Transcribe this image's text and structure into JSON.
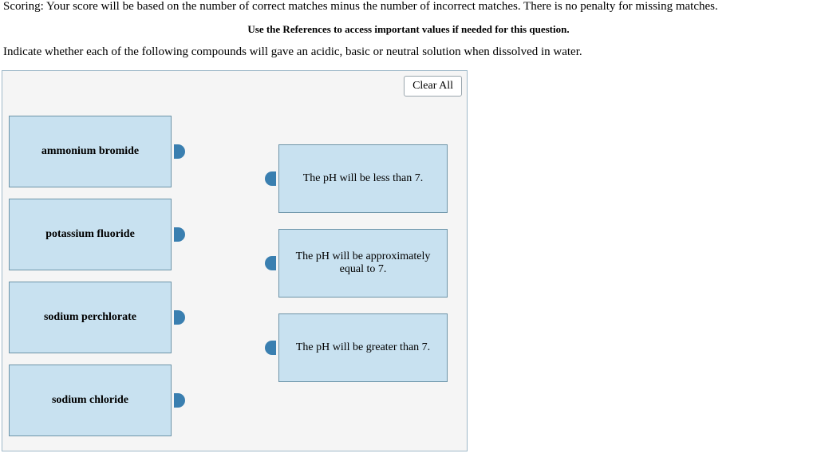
{
  "scoring_text": "Scoring: Your score will be based on the number of correct matches minus the number of incorrect matches. There is no penalty for missing matches.",
  "references_text": "Use the References to access important values if needed for this question.",
  "question_text": "Indicate whether each of the following compounds will gave an acidic, basic or neutral solution when dissolved in water.",
  "clear_all_label": "Clear All",
  "compounds": {
    "0": "ammonium bromide",
    "1": "potassium fluoride",
    "2": "sodium perchlorate",
    "3": "sodium chloride"
  },
  "targets": {
    "0": "The pH will be less than 7.",
    "1": "The pH will be approximately equal to 7.",
    "2": "The pH will be greater than 7."
  }
}
